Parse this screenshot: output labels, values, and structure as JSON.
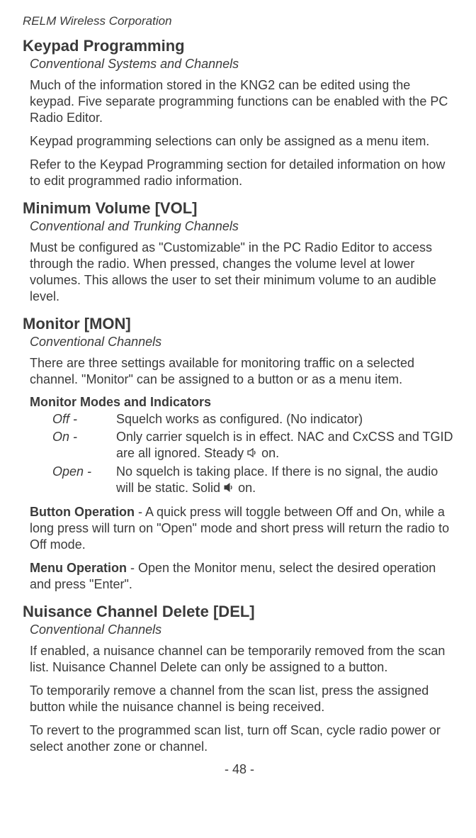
{
  "header": {
    "corporation": "RELM Wireless Corporation"
  },
  "sections": {
    "keypad": {
      "title": "Keypad Programming",
      "subtitle": "Conventional Systems and Channels",
      "para1": "Much of the information stored in the KNG2 can be edited using the keypad. Five separate programming functions can be enabled with the PC Radio Editor.",
      "para2": "Keypad programming selections can only be assigned as a menu item.",
      "para3": "Refer to the Keypad Programming section for detailed information on how to edit programmed radio information."
    },
    "volume": {
      "title": "Minimum Volume [VOL]",
      "subtitle": "Conventional and Trunking Channels",
      "para1": "Must be configured as \"Customizable\" in the PC Radio Editor to access through the radio. When pressed, changes the volume level at lower volumes. This allows the user to set their minimum volume to an audible level."
    },
    "monitor": {
      "title": "Monitor [MON]",
      "subtitle": "Conventional Channels",
      "para1": "There are three settings available for monitoring traffic on a selected channel. \"Monitor\" can be assigned to a button or as a menu item.",
      "modes_heading": "Monitor Modes and Indicators",
      "modes": {
        "off": {
          "label": "Off -",
          "desc": "Squelch works as configured. (No indicator)"
        },
        "on": {
          "label": "On -",
          "desc_pre": "Only carrier squelch is in effect. NAC and CxCSS and TGID are all ignored. Steady ",
          "desc_post": " on."
        },
        "open": {
          "label": "Open -",
          "desc_pre": "No squelch is taking place. If there is no signal, the audio will be static. Solid ",
          "desc_post": " on."
        }
      },
      "button_op_label": "Button Operation",
      "button_op_text": " - A quick press will toggle between Off and On, while a long press will turn on \"Open\" mode and short press will return the radio to Off mode.",
      "menu_op_label": "Menu Operation",
      "menu_op_text": " - Open the Monitor menu, select the desired operation and press \"Enter\"."
    },
    "nuisance": {
      "title": "Nuisance Channel Delete [DEL]",
      "subtitle": "Conventional Channels",
      "para1": "If enabled, a nuisance channel can be temporarily removed from the scan list. Nuisance Channel Delete can only be assigned to a button.",
      "para2": "To temporarily remove a channel from the scan list, press the assigned button while the nuisance channel is being received.",
      "para3": "To revert to the programmed scan list, turn off Scan, cycle radio power or select another zone or channel."
    }
  },
  "footer": {
    "page": "- 48 -"
  }
}
